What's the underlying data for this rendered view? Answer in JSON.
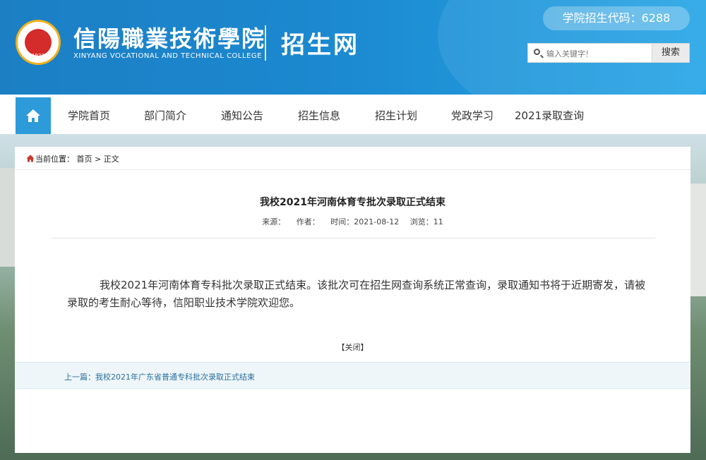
{
  "header": {
    "school_name_cn": "信陽職業技術學院",
    "school_name_en": "XINYANG VOCATIONAL AND TECHNICAL COLLEGE",
    "site_name": "招生网",
    "admission_code": "学院招生代码：6288",
    "logo_year": "1923"
  },
  "search": {
    "placeholder": "输入关键字！",
    "button_label": "搜索"
  },
  "nav": {
    "items": [
      {
        "label": "学院首页"
      },
      {
        "label": "部门简介"
      },
      {
        "label": "通知公告"
      },
      {
        "label": "招生信息"
      },
      {
        "label": "招生计划"
      },
      {
        "label": "党政学习"
      },
      {
        "label": "2021录取查询"
      }
    ]
  },
  "breadcrumb": {
    "prefix": "当前位置：",
    "home": "首页",
    "separator": ">",
    "current": "正文"
  },
  "article": {
    "title": "我校2021年河南体育专批次录取正式结束",
    "source": "来源：",
    "author": "作者：",
    "time": "时间：2021-08-12",
    "views": "浏览：11",
    "body": "我校2021年河南体育专科批次录取正式结束。该批次可在招生网查询系统正常查询，录取通知书将于近期寄发，请被录取的考生耐心等待，信阳职业技术学院欢迎您。",
    "close_label": "【关闭】",
    "prev_label": "上一篇：我校2021年广东省普通专科批次录取正式结束"
  },
  "colors": {
    "header_blue": "#1c7fc4",
    "nav_home_blue": "#2d9ad9",
    "link_blue": "#2a6f9e"
  }
}
